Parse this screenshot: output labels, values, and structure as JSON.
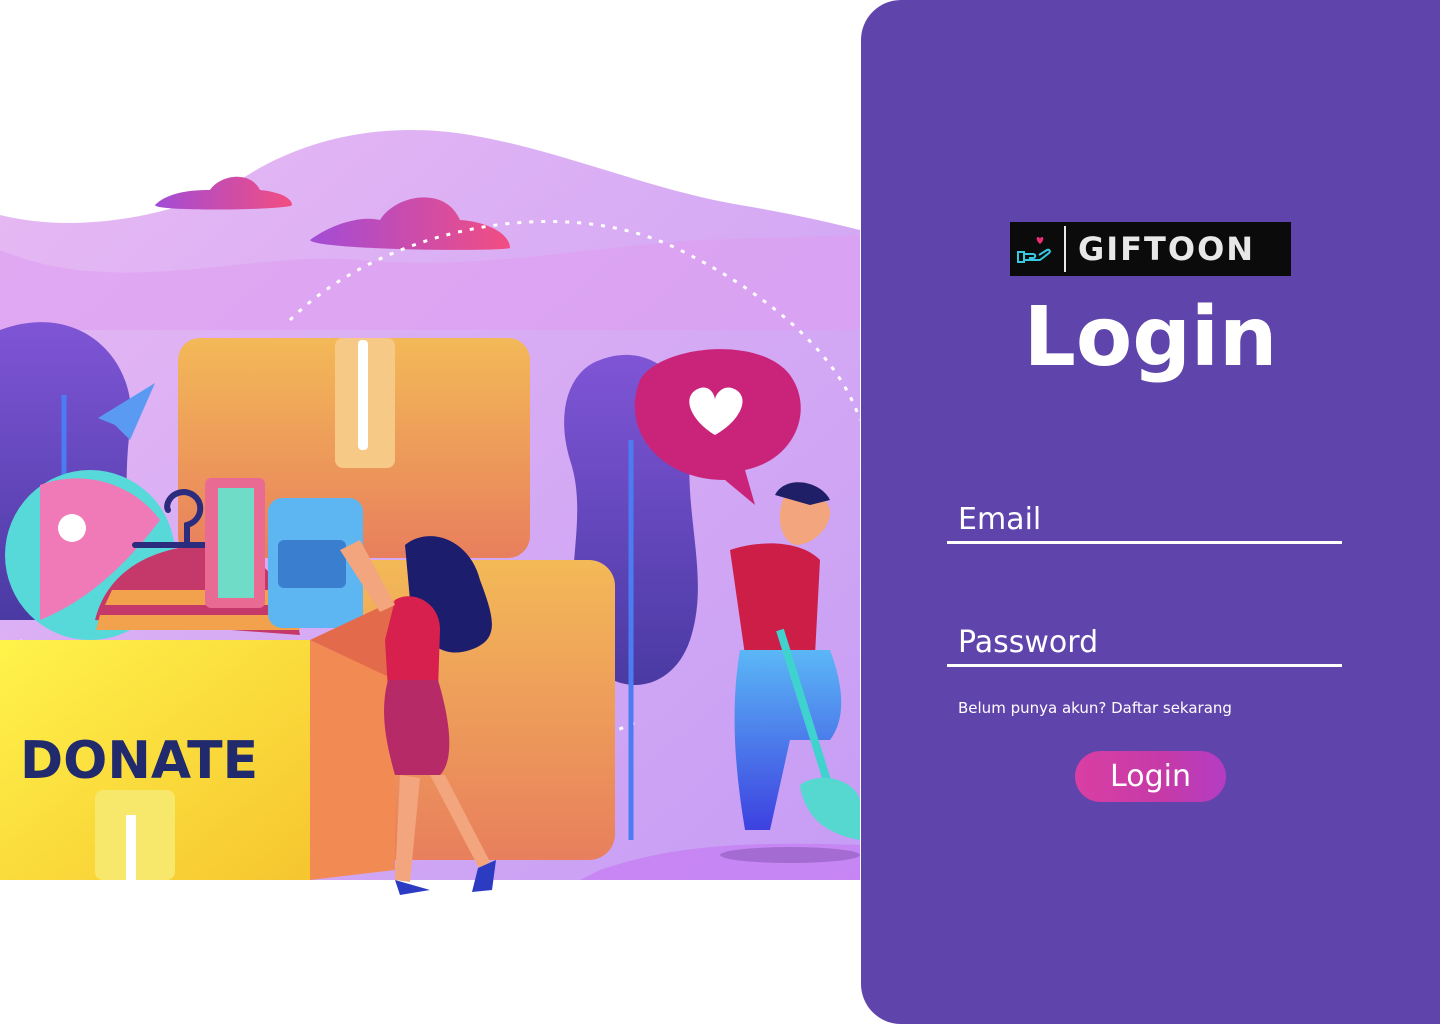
{
  "illustration": {
    "box_label": "DONATE"
  },
  "brand": {
    "name": "GIFTOON",
    "logo_icon": "hand-heart-icon"
  },
  "page": {
    "title": "Login"
  },
  "form": {
    "email_placeholder": "Email",
    "password_placeholder": "Password",
    "register_link": "Belum punya akun? Daftar sekarang",
    "submit_label": "Login"
  },
  "colors": {
    "panel": "#5f44ab",
    "button_gradient_start": "#d93fa3",
    "button_gradient_end": "#b43cc4",
    "text": "#ffffff"
  }
}
